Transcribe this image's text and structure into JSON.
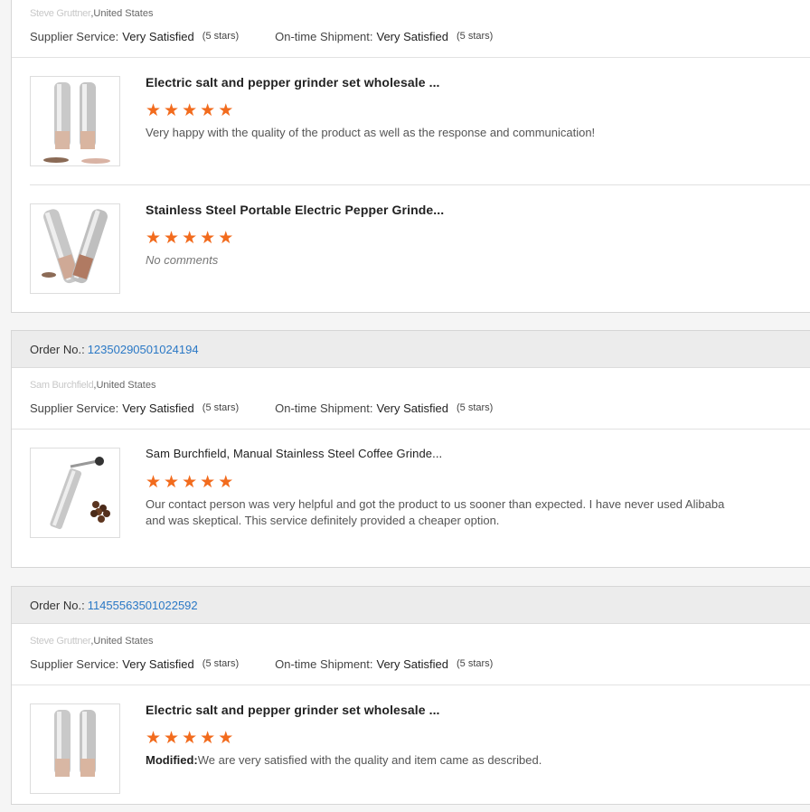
{
  "accent": "#2a78c5",
  "star_color": "#f26b1d",
  "labels": {
    "order_no": "Order No.:",
    "supplier_service": "Supplier Service:",
    "ontime_shipment": "On-time Shipment:"
  },
  "orders": [
    {
      "buyer_name": "Steve Gruttner",
      "buyer_country": ",United States",
      "supplier_service": "Very Satisfied",
      "supplier_stars": "(5 stars)",
      "ontime": "Very Satisfied",
      "ontime_stars": "(5 stars)",
      "items": [
        {
          "title": "Electric salt and pepper grinder set wholesale ...",
          "rating": 5,
          "comment": "Very happy with the quality of the product as well as the response and communication!",
          "image": "grinder-pair-icon"
        },
        {
          "title": "Stainless Steel Portable Electric Pepper Grinde...",
          "rating": 5,
          "comment": "No comments",
          "image": "grinder-crossed-icon"
        }
      ]
    },
    {
      "order_number": "12350290501024194",
      "buyer_name": "Sam Burchfield",
      "buyer_country": ",United States",
      "supplier_service": "Very Satisfied",
      "supplier_stars": "(5 stars)",
      "ontime": "Very Satisfied",
      "ontime_stars": "(5 stars)",
      "items": [
        {
          "title": "Sam Burchfield, Manual Stainless Steel Coffee Grinde...",
          "rating": 5,
          "comment": "Our contact person was very helpful and got the product to us sooner than expected. I have never used Alibaba and was skeptical. This service definitely provided a cheaper option.",
          "image": "coffee-grinder-icon"
        }
      ]
    },
    {
      "order_number": "11455563501022592",
      "buyer_name": "Steve Gruttner",
      "buyer_country": ",United States",
      "supplier_service": "Very Satisfied",
      "supplier_stars": "(5 stars)",
      "ontime": "Very Satisfied",
      "ontime_stars": "(5 stars)",
      "items": [
        {
          "title": "Electric salt and pepper grinder set wholesale ...",
          "rating": 5,
          "modified_label": "Modified:",
          "comment": "We are very satisfied with the quality and item came as described.",
          "image": "grinder-pair-icon"
        }
      ]
    }
  ]
}
